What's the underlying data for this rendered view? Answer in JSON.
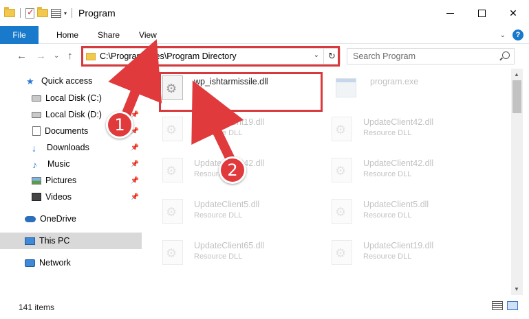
{
  "window": {
    "title": "Program",
    "controls": {
      "minimize": "",
      "maximize": "",
      "close": "✕"
    }
  },
  "ribbon": {
    "tabs": [
      "File",
      "Home",
      "Share",
      "View"
    ],
    "help": "?"
  },
  "address": {
    "path": "C:\\Program Files\\Program Directory",
    "refresh_glyph": "↻",
    "dropdown_glyph": "⌄"
  },
  "search": {
    "placeholder": "Search Program"
  },
  "nav": {
    "back": "←",
    "forward": "→",
    "recent": "⌄",
    "up": "↑"
  },
  "sidebar": {
    "items": [
      {
        "label": "Quick access",
        "icon": "star-icon",
        "pinned": false
      },
      {
        "label": "Local Disk (C:)",
        "icon": "disk-icon",
        "pinned": true
      },
      {
        "label": "Local Disk (D:)",
        "icon": "disk-icon",
        "pinned": true
      },
      {
        "label": "Documents",
        "icon": "documents-icon",
        "pinned": true
      },
      {
        "label": "Downloads",
        "icon": "download-icon",
        "pinned": true
      },
      {
        "label": "Music",
        "icon": "music-icon",
        "pinned": true
      },
      {
        "label": "Pictures",
        "icon": "pictures-icon",
        "pinned": true
      },
      {
        "label": "Videos",
        "icon": "videos-icon",
        "pinned": true
      },
      {
        "label": "OneDrive",
        "icon": "cloud-icon",
        "pinned": false
      },
      {
        "label": "This PC",
        "icon": "pc-icon",
        "pinned": false,
        "selected": true
      },
      {
        "label": "Network",
        "icon": "network-icon",
        "pinned": false
      }
    ],
    "pin_glyph": "📌"
  },
  "files": {
    "highlighted": {
      "name": "wp_ishtarmissile.dll",
      "type": ""
    },
    "program": {
      "name": "program.exe",
      "type": ""
    },
    "faded": [
      {
        "name": "UpdateClient19.dll",
        "type": "Resource DLL"
      },
      {
        "name": "UpdateClient42.dll",
        "type": "Resource DLL"
      },
      {
        "name": "UpdateClient42.dll",
        "type": "Resource DLL"
      },
      {
        "name": "UpdateClient42.dll",
        "type": "Resource DLL"
      },
      {
        "name": "UpdateClient5.dll",
        "type": "Resource DLL"
      },
      {
        "name": "UpdateClient5.dll",
        "type": "Resource DLL"
      },
      {
        "name": "UpdateClient65.dll",
        "type": "Resource DLL"
      },
      {
        "name": "UpdateClient19.dll",
        "type": "Resource DLL"
      }
    ]
  },
  "status": {
    "item_count": "141 items"
  },
  "annotations": {
    "step1": "1",
    "step2": "2",
    "color": "#d9393c"
  }
}
